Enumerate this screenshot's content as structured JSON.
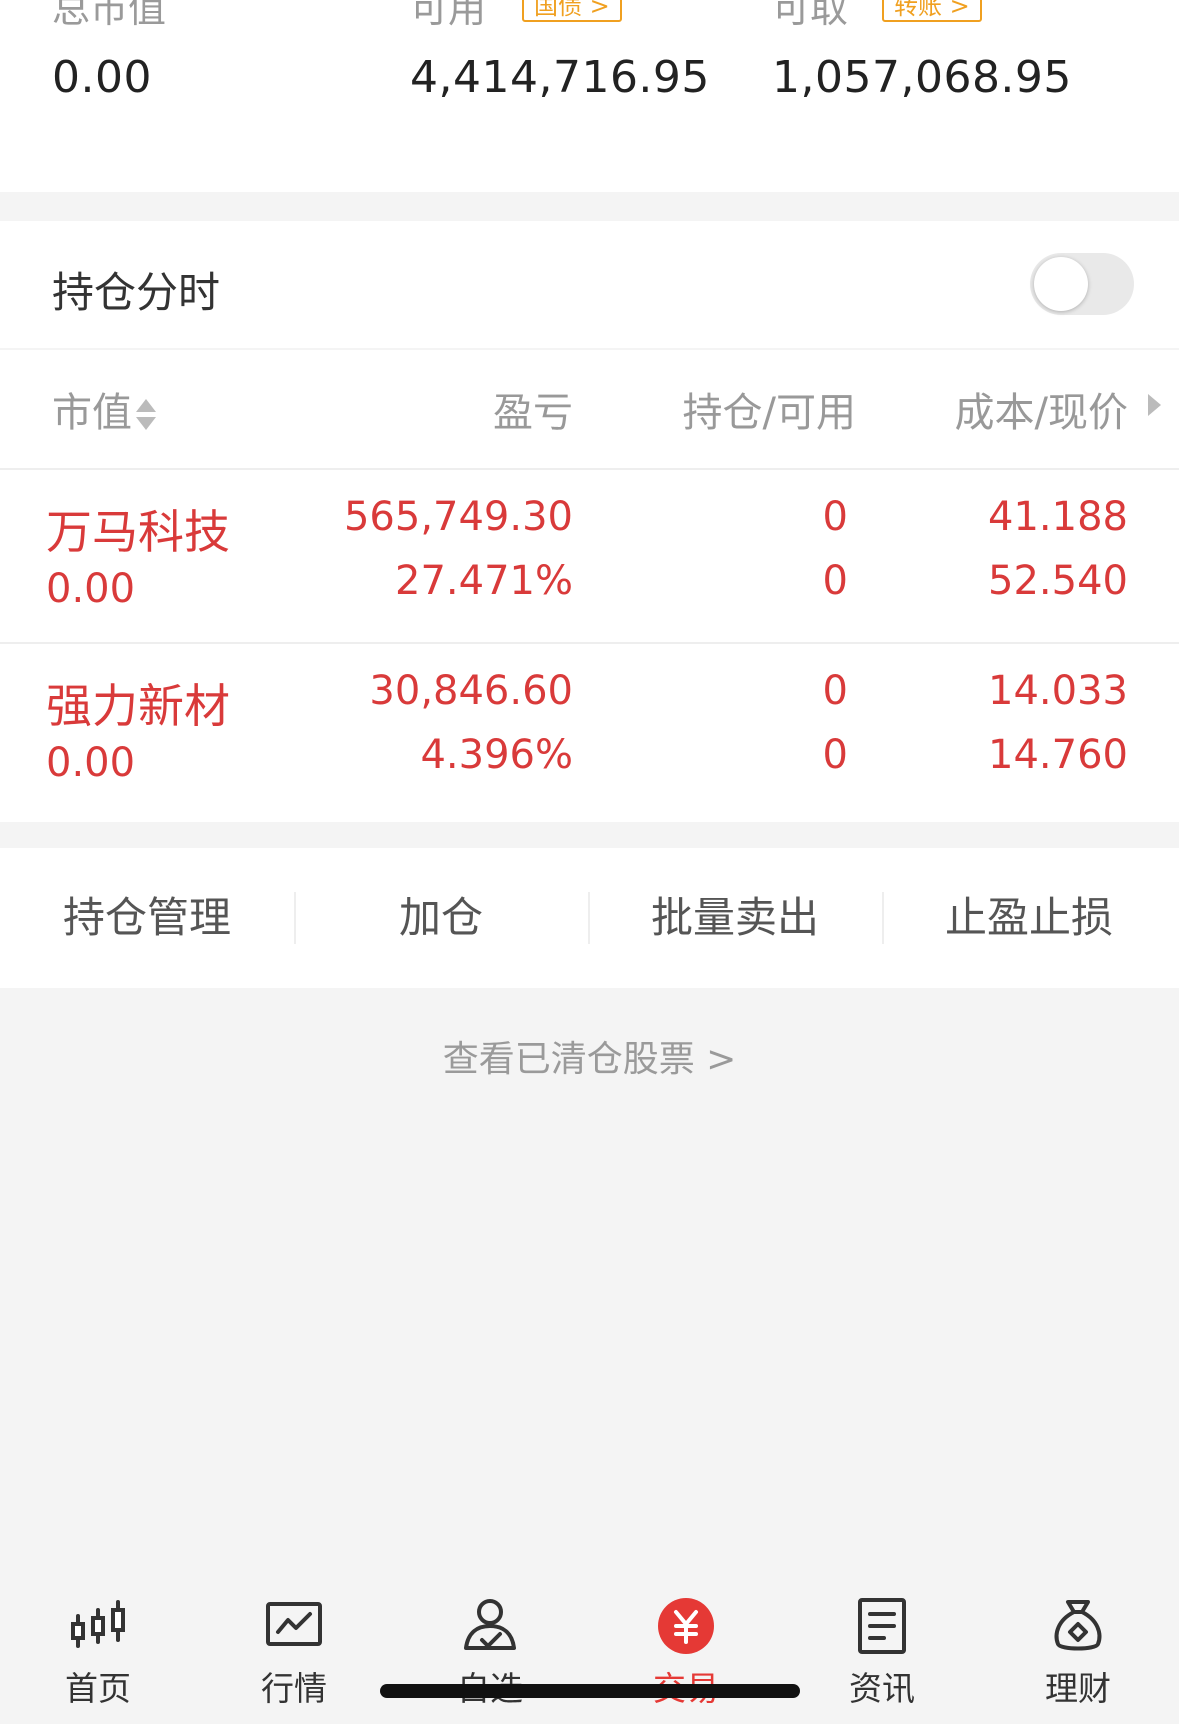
{
  "summary": {
    "total_mv_label": "总市值",
    "total_mv_value": "0.00",
    "available_label": "可用",
    "available_badge": "国债",
    "available_value": "4,414,716.95",
    "withdrawable_label": "可取",
    "withdrawable_badge": "转账",
    "withdrawable_value": "1,057,068.95"
  },
  "toggle": {
    "label": "持仓分时",
    "state": "off"
  },
  "table": {
    "headers": [
      "市值",
      "盈亏",
      "持仓/可用",
      "成本/现价"
    ],
    "rows": [
      {
        "name": "万马科技",
        "market_value": "0.00",
        "pnl": "565,749.30",
        "pnl_pct": "27.471%",
        "position": "0",
        "available": "0",
        "cost": "41.188",
        "price": "52.540"
      },
      {
        "name": "强力新材",
        "market_value": "0.00",
        "pnl": "30,846.60",
        "pnl_pct": "4.396%",
        "position": "0",
        "available": "0",
        "cost": "14.033",
        "price": "14.760"
      }
    ]
  },
  "actions": [
    "持仓管理",
    "加仓",
    "批量卖出",
    "止盈止损"
  ],
  "cleared_link": "查看已清仓股票  >",
  "nav": {
    "items": [
      {
        "label": "首页",
        "icon": "candlestick-icon"
      },
      {
        "label": "行情",
        "icon": "chart-icon"
      },
      {
        "label": "自选",
        "icon": "person-check-icon"
      },
      {
        "label": "交易",
        "icon": "yuan-icon",
        "active": true
      },
      {
        "label": "资讯",
        "icon": "document-icon"
      },
      {
        "label": "理财",
        "icon": "money-bag-icon"
      }
    ],
    "active_color": "#e53935"
  },
  "colors": {
    "profit_red": "#d93a3a",
    "badge_orange": "#f0a020",
    "background": "#f4f4f4"
  }
}
